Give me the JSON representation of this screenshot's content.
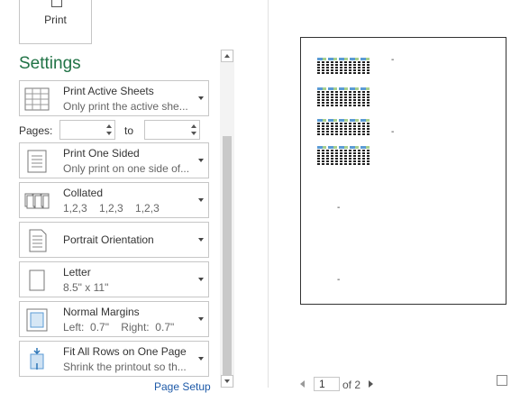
{
  "print": {
    "label": "Print"
  },
  "settings": {
    "title": "Settings"
  },
  "options": [
    {
      "title": "Print Active Sheets",
      "subtitle": "Only print the active she..."
    },
    {
      "title": "Print One Sided",
      "subtitle": "Only print on one side of..."
    },
    {
      "title": "Collated",
      "subtitle": "1,2,3    1,2,3    1,2,3"
    },
    {
      "title": "Portrait Orientation"
    },
    {
      "title": "Letter",
      "subtitle": "8.5\" x 11\""
    },
    {
      "title": "Normal Margins",
      "subtitle": "Left:  0.7\"    Right:  0.7\""
    },
    {
      "title": "Fit All Rows on One Page",
      "subtitle": "Shrink the printout so th..."
    }
  ],
  "pages": {
    "label": "Pages:",
    "to_label": "to",
    "from_value": "",
    "to_value": ""
  },
  "page_setup": {
    "label": "Page Setup"
  },
  "preview": {
    "dash": "-"
  },
  "navigation": {
    "current_page": "1",
    "of_text": "of 2"
  }
}
